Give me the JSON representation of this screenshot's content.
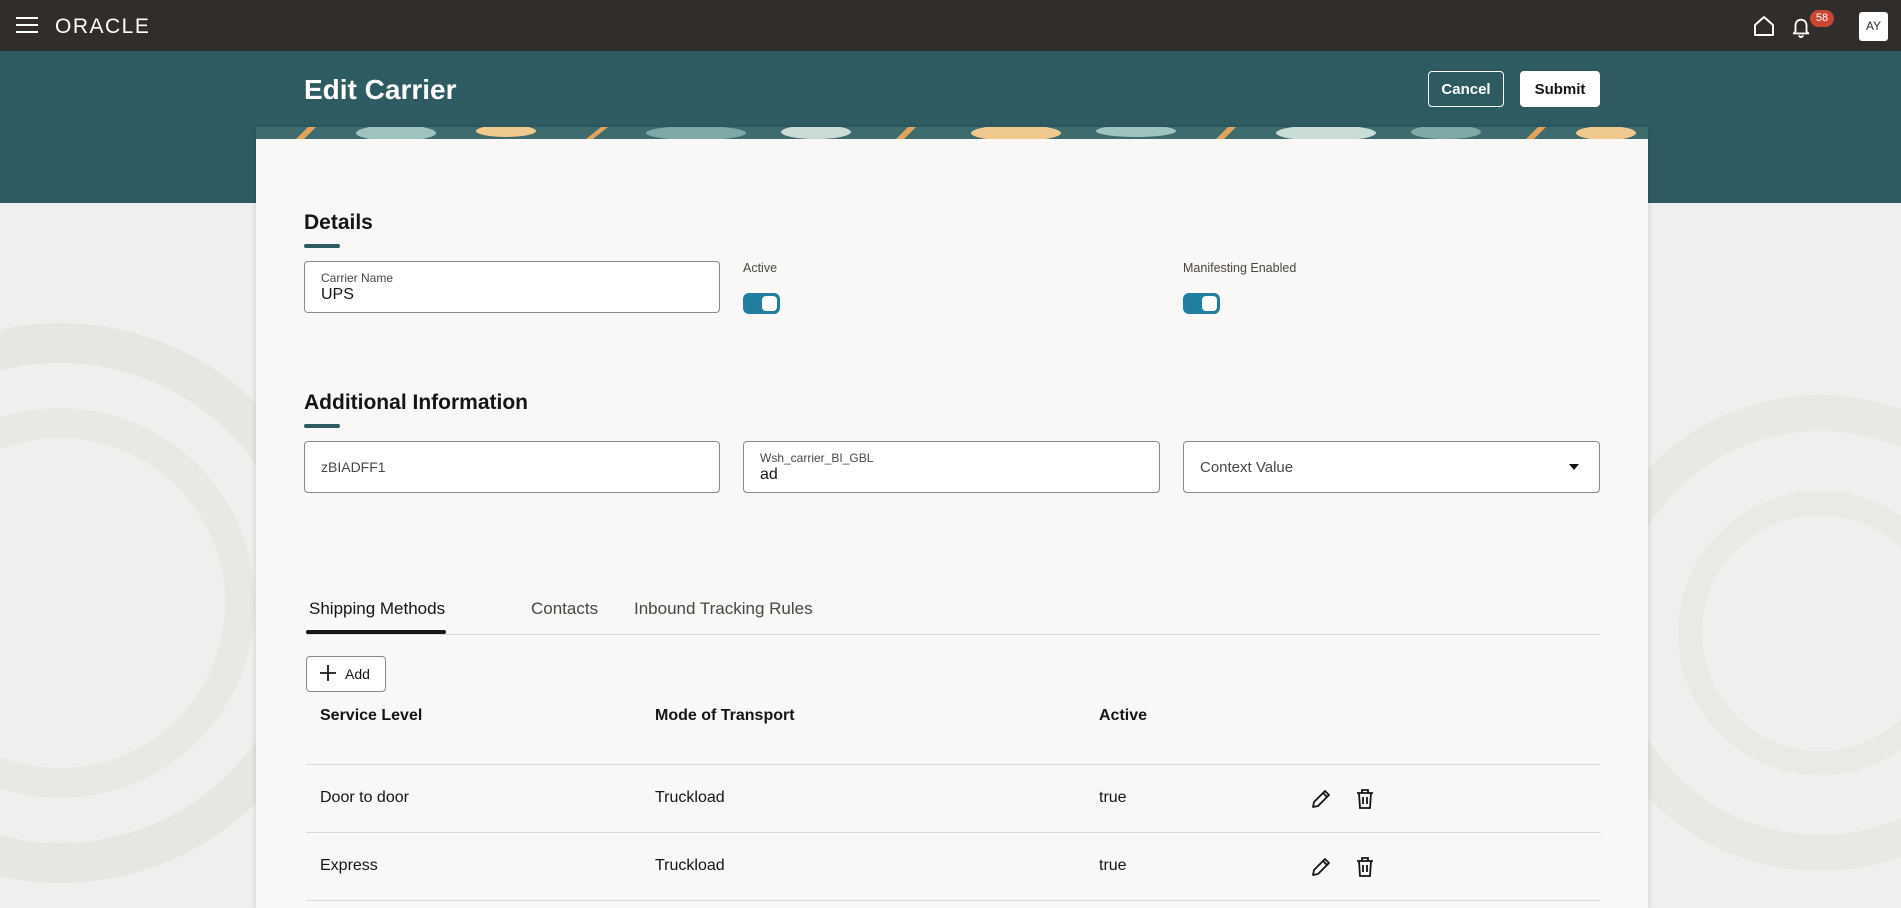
{
  "topbar": {
    "logo": "ORACLE",
    "notification_count": "58",
    "user_initials": "AY",
    "icons": [
      "hamburger-menu-icon",
      "home-icon",
      "bell-icon"
    ]
  },
  "header": {
    "title": "Edit Carrier",
    "cancel_label": "Cancel",
    "submit_label": "Submit"
  },
  "details": {
    "title": "Details",
    "carrier_name_label": "Carrier Name",
    "carrier_name_value": "UPS",
    "active_label": "Active",
    "active_value": true,
    "manifesting_label": "Manifesting Enabled",
    "manifesting_value": true
  },
  "additional": {
    "title": "Additional Information",
    "field1_placeholder": "zBIADFF1",
    "field2_label": "Wsh_carrier_BI_GBL",
    "field2_value": "ad",
    "context_placeholder": "Context Value"
  },
  "tabs": [
    {
      "label": "Shipping Methods",
      "active": true
    },
    {
      "label": "Contacts",
      "active": false
    },
    {
      "label": "Inbound Tracking Rules",
      "active": false
    }
  ],
  "add_label": "Add",
  "table": {
    "columns": [
      "Service Level",
      "Mode of Transport",
      "Active"
    ],
    "rows": [
      {
        "service_level": "Door to door",
        "mode": "Truckload",
        "active": "true"
      },
      {
        "service_level": "Express",
        "mode": "Truckload",
        "active": "true"
      }
    ]
  },
  "colors": {
    "topbar": "#312d2a",
    "header_band": "#2e5a61",
    "toggle_on": "#227e9e",
    "badge": "#c74634"
  }
}
